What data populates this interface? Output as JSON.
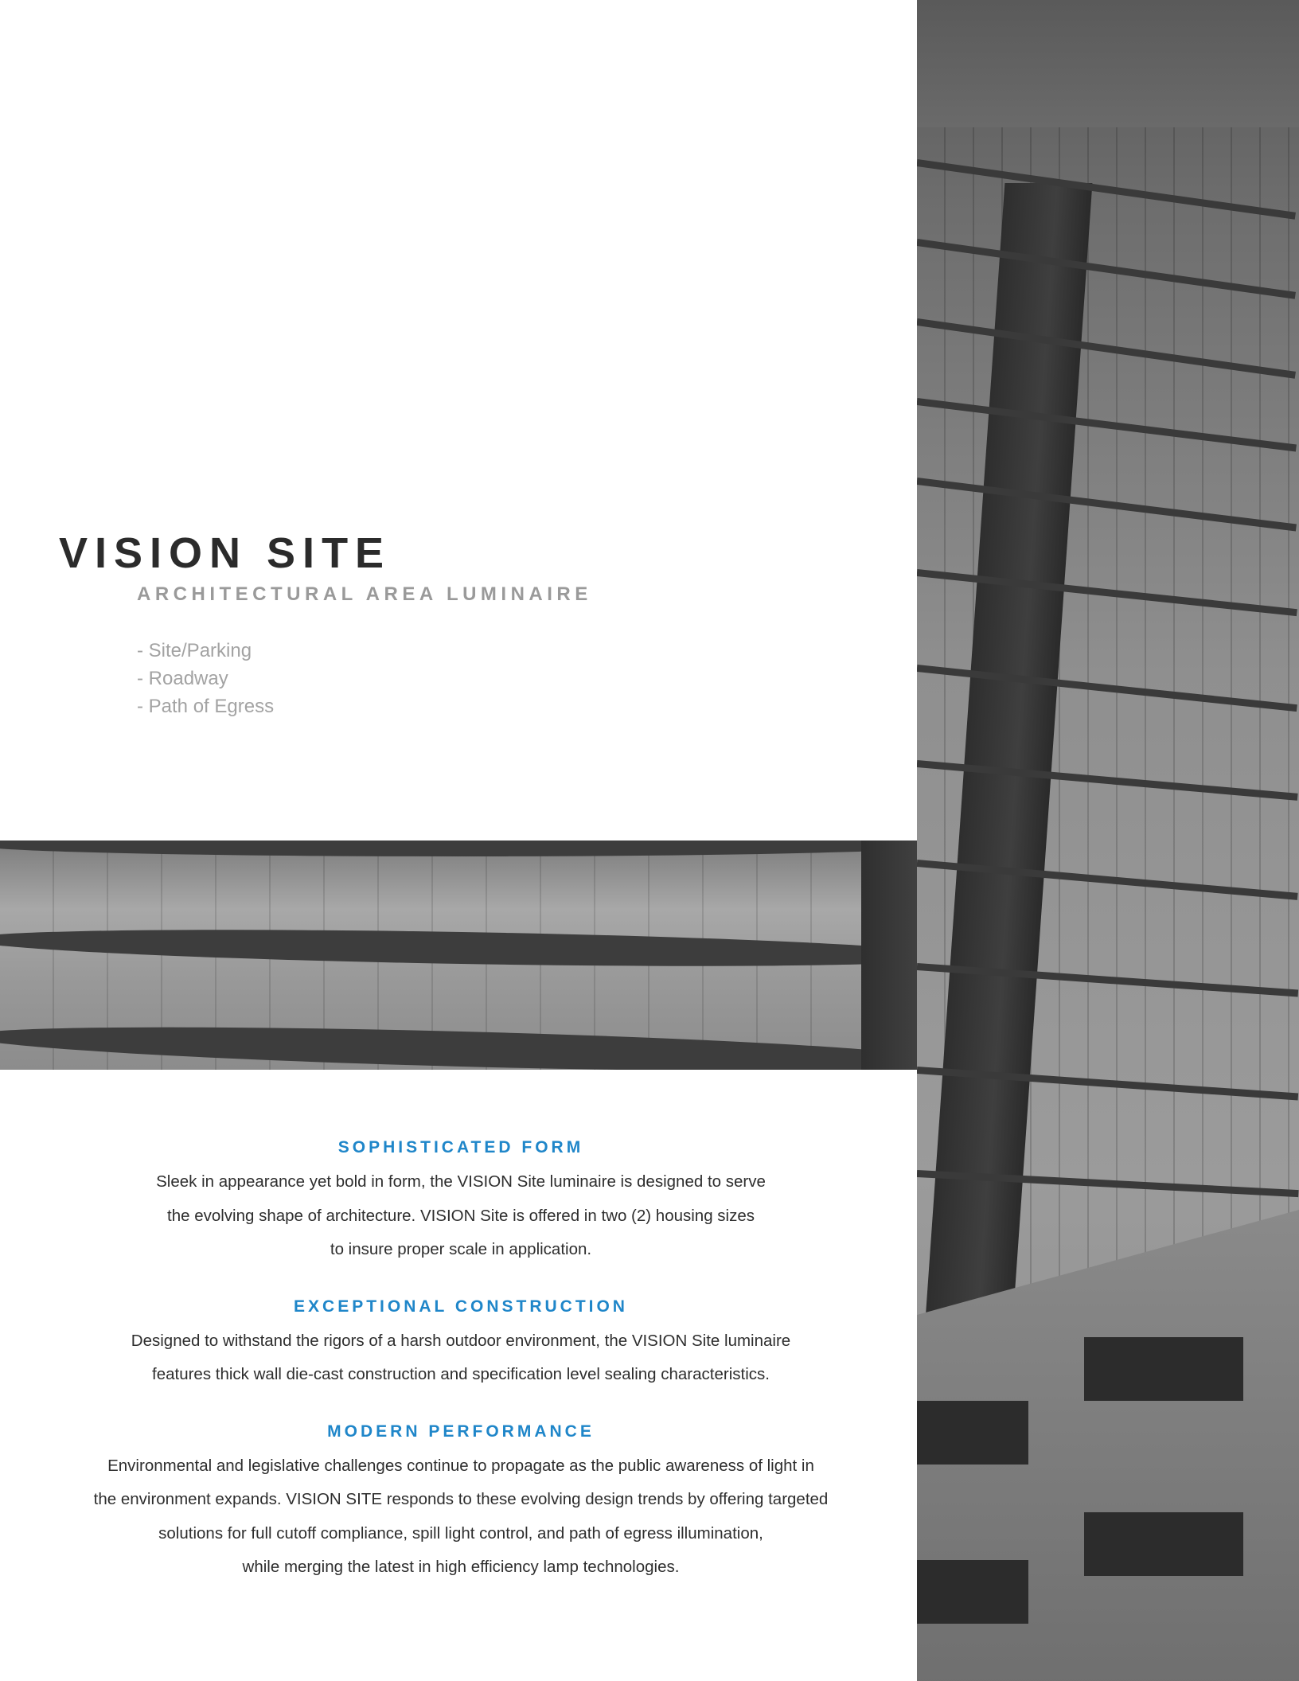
{
  "title": "VISION SITE",
  "subtitle": "ARCHITECTURAL AREA LUMINAIRE",
  "applications": [
    "- Site/Parking",
    "- Roadway",
    "- Path of Egress"
  ],
  "features": [
    {
      "heading": "SOPHISTICATED FORM",
      "lines": [
        "Sleek in appearance yet bold in form, the VISION Site luminaire is designed to serve",
        "the evolving shape of architecture. VISION Site is offered in two (2) housing sizes",
        "to insure proper scale in application."
      ]
    },
    {
      "heading": "EXCEPTIONAL CONSTRUCTION",
      "lines": [
        "Designed to withstand the rigors of a harsh outdoor environment, the VISION Site luminaire",
        "features thick wall die-cast construction and specification level sealing characteristics."
      ]
    },
    {
      "heading": "MODERN PERFORMANCE",
      "lines": [
        "Environmental and legislative challenges continue to propagate as the public awareness of light in",
        "the environment expands. VISION SITE responds to these evolving design trends by offering targeted",
        "solutions for full cutoff compliance, spill light control, and path of egress illumination,",
        "while merging the latest in high efficiency lamp technologies."
      ]
    }
  ],
  "colors": {
    "heading_accent": "#1f86c9",
    "title": "#2b2b2b",
    "subtitle": "#9a9a9a",
    "body_text": "#2e2e2e"
  }
}
